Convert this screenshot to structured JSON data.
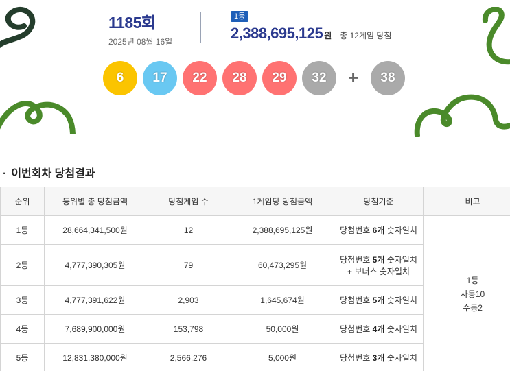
{
  "draw": {
    "round_number": "1185",
    "round_suffix": "회",
    "date": "2025년 08월 16일"
  },
  "first_prize": {
    "badge": "1등",
    "amount": "2,388,695,125",
    "unit": "원",
    "winners_text": "총 12게임 당첨"
  },
  "colors": {
    "yellow": "#fbc400",
    "blue": "#69c8f2",
    "red": "#ff7272",
    "gray": "#aaaaaa",
    "navy": "#2b3a8f",
    "badge": "#1f5fb8",
    "decor_green": "#4a8a2a",
    "decor_dark": "#243d2c"
  },
  "balls": [
    {
      "number": "6",
      "color": "#fbc400"
    },
    {
      "number": "17",
      "color": "#69c8f2"
    },
    {
      "number": "22",
      "color": "#ff7272"
    },
    {
      "number": "28",
      "color": "#ff7272"
    },
    {
      "number": "29",
      "color": "#ff7272"
    },
    {
      "number": "32",
      "color": "#aaaaaa"
    }
  ],
  "bonus_ball": {
    "number": "38",
    "color": "#aaaaaa"
  },
  "plus_sign": "+",
  "section": {
    "bullet": "·",
    "title": "이번회차 당첨결과"
  },
  "table": {
    "headers": [
      "순위",
      "등위별 총 당첨금액",
      "당첨게임 수",
      "1게임당 당첨금액",
      "당첨기준",
      "비고"
    ],
    "rows": [
      {
        "rank": "1등",
        "total": "28,664,341,500원",
        "games": "12",
        "per_game": "2,388,695,125원",
        "criteria_pre": "당첨번호 ",
        "criteria_bold": "6개",
        "criteria_post": " 숫자일치",
        "criteria_line2": ""
      },
      {
        "rank": "2등",
        "total": "4,777,390,305원",
        "games": "79",
        "per_game": "60,473,295원",
        "criteria_pre": "당첨번호 ",
        "criteria_bold": "5개",
        "criteria_post": " 숫자일치",
        "criteria_line2": "+ 보너스 숫자일치"
      },
      {
        "rank": "3등",
        "total": "4,777,391,622원",
        "games": "2,903",
        "per_game": "1,645,674원",
        "criteria_pre": "당첨번호 ",
        "criteria_bold": "5개",
        "criteria_post": " 숫자일치",
        "criteria_line2": ""
      },
      {
        "rank": "4등",
        "total": "7,689,900,000원",
        "games": "153,798",
        "per_game": "50,000원",
        "criteria_pre": "당첨번호 ",
        "criteria_bold": "4개",
        "criteria_post": " 숫자일치",
        "criteria_line2": ""
      },
      {
        "rank": "5등",
        "total": "12,831,380,000원",
        "games": "2,566,276",
        "per_game": "5,000원",
        "criteria_pre": "당첨번호 ",
        "criteria_bold": "3개",
        "criteria_post": " 숫자일치",
        "criteria_line2": ""
      }
    ],
    "note_lines": [
      "1등",
      "자동10",
      "수동2"
    ]
  }
}
